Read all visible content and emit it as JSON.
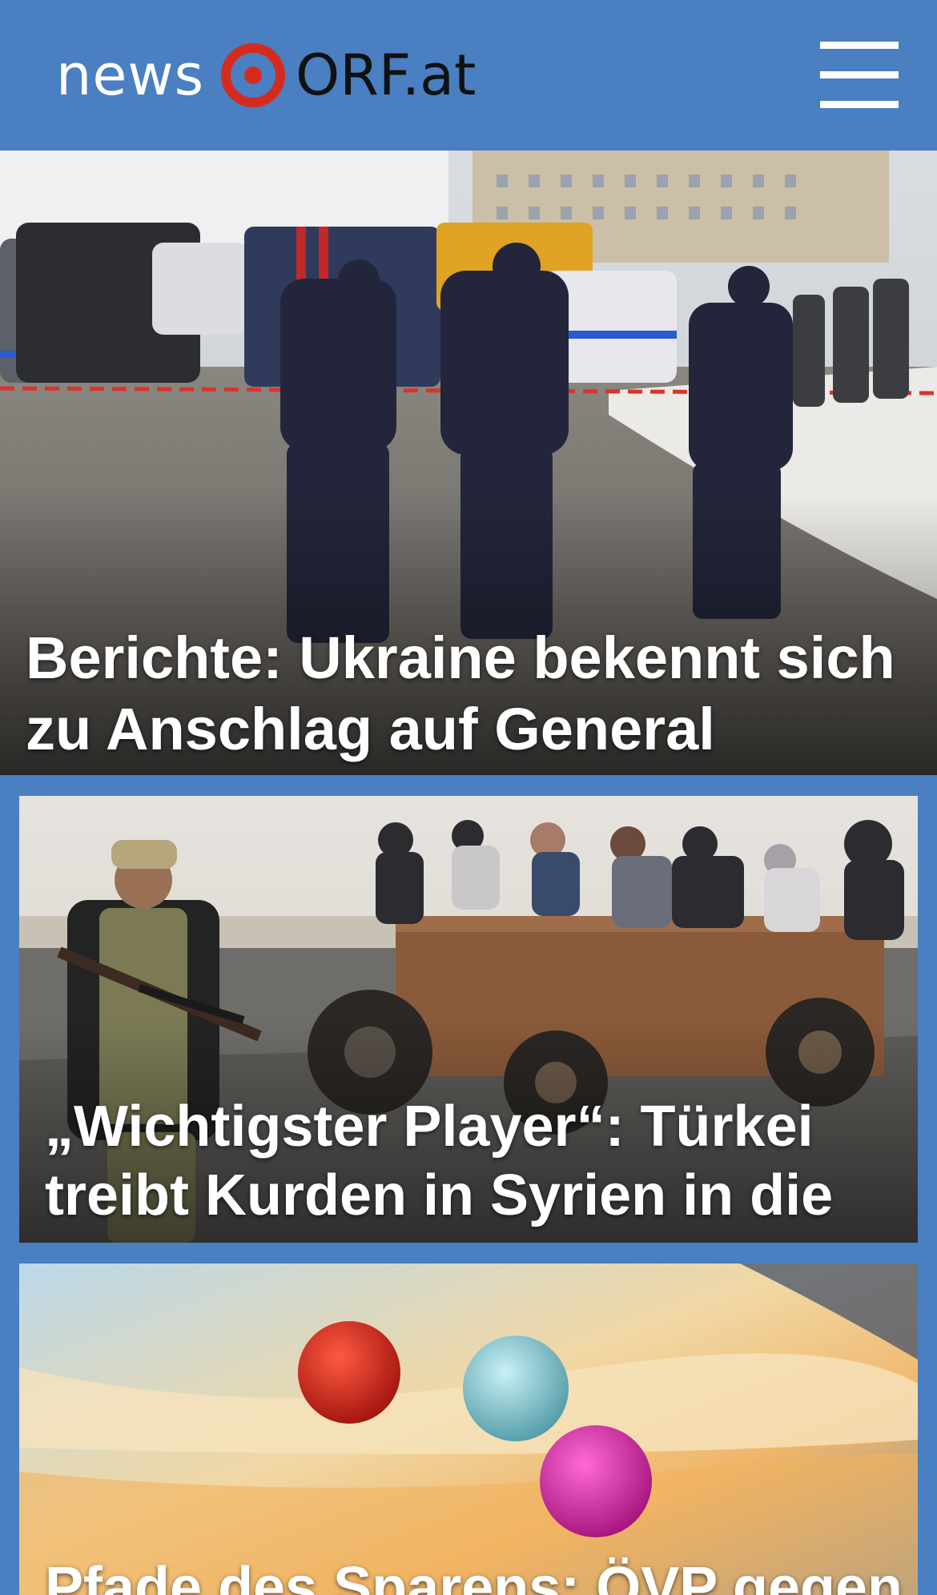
{
  "header": {
    "logo_news": "news",
    "logo_orf": "ORF.at",
    "menu_icon": "hamburger-menu-icon",
    "colors": {
      "background": "#4a7fc1",
      "logo_red": "#d52b1e"
    }
  },
  "articles": [
    {
      "headline": "Berichte: Ukraine bekennt sich zu Anschlag auf General"
    },
    {
      "headline": "„Wichtigster Player“: Türkei treibt Kurden in Syrien in die Enge"
    },
    {
      "headline": "Pfade des Sparens: ÖVP gegen, SPÖ"
    }
  ]
}
